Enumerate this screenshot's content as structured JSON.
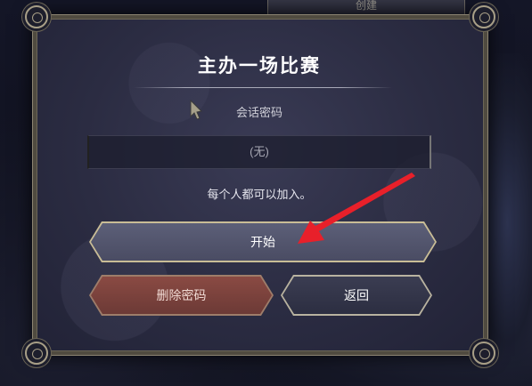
{
  "background": {
    "create_label": "创建"
  },
  "dialog": {
    "title": "主办一场比赛",
    "password_label": "会话密码",
    "password_value": "(无)",
    "info_text": "每个人都可以加入。"
  },
  "buttons": {
    "start_label": "开始",
    "delete_password_label": "删除密码",
    "back_label": "返回"
  },
  "colors": {
    "annotation_arrow": "#e8202a",
    "delete_button": "#7a403b",
    "frame_gold": "#a89f87"
  },
  "icons": {
    "cursor": "pointer-cursor-icon",
    "annotation": "red-arrow-icon"
  }
}
